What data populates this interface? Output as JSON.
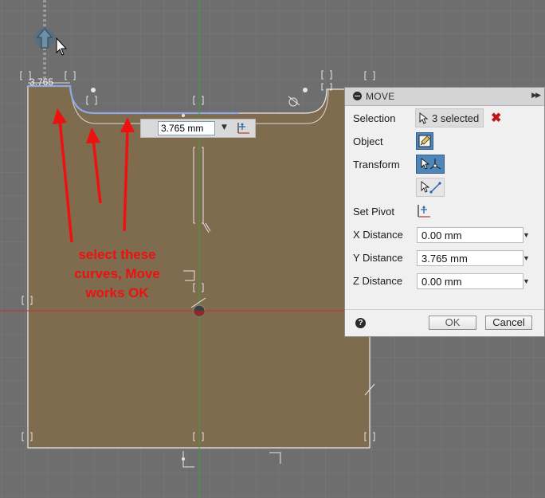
{
  "viewport": {
    "dimension_label": "3.765",
    "dimension_input": {
      "value": "3.765 mm"
    }
  },
  "annotation": {
    "lines": [
      "select these",
      "curves, Move",
      "works OK"
    ],
    "color": "#ee1111"
  },
  "move_dialog": {
    "title": "MOVE",
    "selection": {
      "label": "Selection",
      "value": "3 selected"
    },
    "object": {
      "label": "Object"
    },
    "transform": {
      "label": "Transform"
    },
    "set_pivot": {
      "label": "Set Pivot"
    },
    "x_distance": {
      "label": "X Distance",
      "value": "0.00 mm"
    },
    "y_distance": {
      "label": "Y Distance",
      "value": "3.765 mm"
    },
    "z_distance": {
      "label": "Z Distance",
      "value": "0.00 mm"
    },
    "ok_label": "OK",
    "cancel_label": "Cancel"
  },
  "colors": {
    "canvas_background": "#6e6e6e",
    "grid_line": "#7b7b7b",
    "sketch_profile_fill": "#7f6b4d",
    "selected_curve": "#8fa9e8",
    "x_axis": "#c03030",
    "y_axis": "#3aa03a",
    "active_button": "#4f86b7"
  }
}
